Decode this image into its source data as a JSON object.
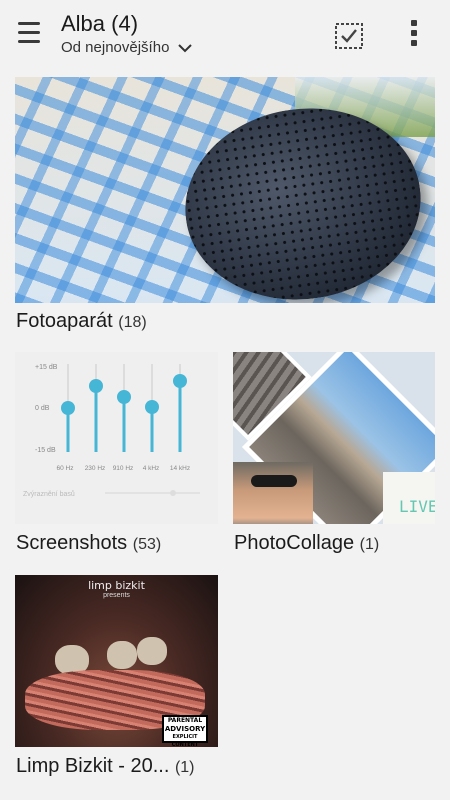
{
  "header": {
    "title": "Alba (4)",
    "sort_label": "Od nejnovějšího"
  },
  "icons": {
    "menu": "hamburger-icon",
    "sort_dropdown": "chevron-down-icon",
    "select": "select-all-icon",
    "overflow": "more-vert-icon"
  },
  "albums": [
    {
      "name": "Fotoaparát",
      "count": "(18)"
    },
    {
      "name": "Screenshots",
      "count": "(53)"
    },
    {
      "name": "PhotoCollage",
      "count": "(1)"
    },
    {
      "name": "Limp Bizkit - 20...",
      "count": "(1)"
    }
  ],
  "screenshot_thumb": {
    "db_labels": [
      "+15 dB",
      "0 dB",
      "-15 dB"
    ],
    "freq_labels": [
      "60 Hz",
      "230 Hz",
      "910 Hz",
      "4 kHz",
      "14 kHz"
    ],
    "bass_label": "Zvýraznění basů",
    "accent": "#45b6d6"
  },
  "collage_thumb": {
    "text": "LIVE"
  },
  "album_art": {
    "band": "limp bizkit",
    "presents": "presents",
    "advisory_lines": [
      "PARENTAL",
      "ADVISORY",
      "EXPLICIT CONTENT"
    ]
  }
}
